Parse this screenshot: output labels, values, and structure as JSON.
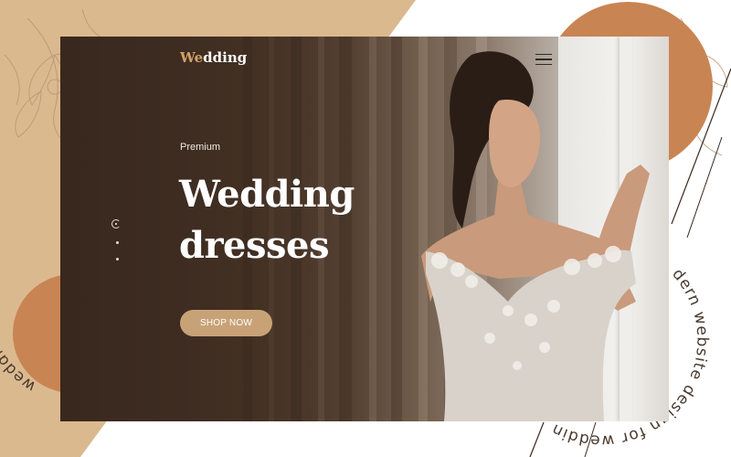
{
  "brand": {
    "logo_accent": "We",
    "logo_rest": "dding"
  },
  "hero": {
    "eyebrow": "Premium",
    "headline_line1": "Wedding",
    "headline_line2": "dresses",
    "cta_label": "SHOP NOW"
  },
  "slider": {
    "total": 3,
    "active": 1
  },
  "decor": {
    "left_curve_text": "wedding ateliers",
    "right_curve_text": "dern website design for wedding"
  },
  "icons": {
    "menu": "hamburger-icon",
    "floral": "floral-line-art"
  },
  "colors": {
    "tan": "#dbb98f",
    "terracotta": "#c98453",
    "accent": "#d4a168",
    "cta": "#c8a277",
    "hero_dark": "#3c2b21"
  }
}
